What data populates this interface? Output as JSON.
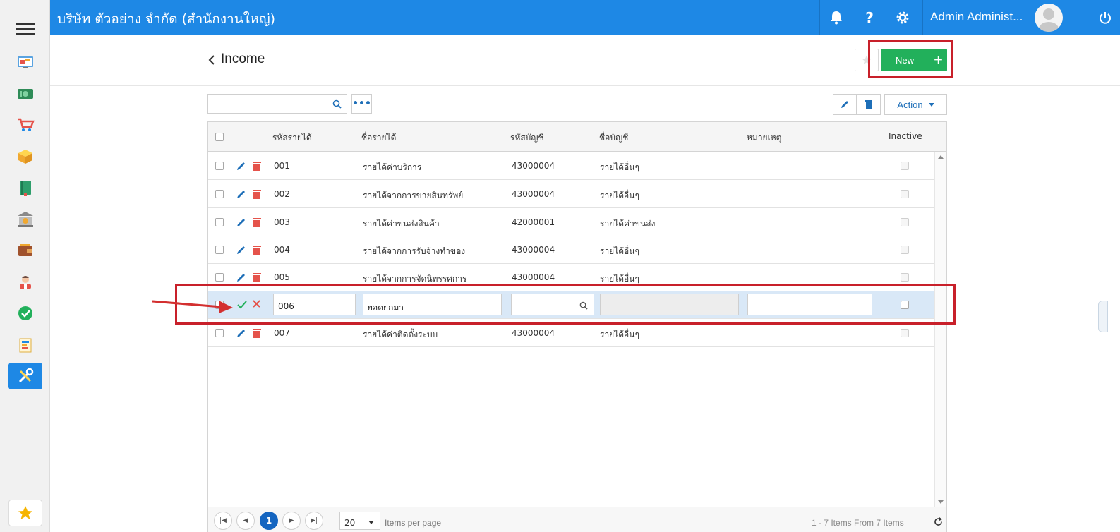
{
  "topbar": {
    "company": "บริษัท ตัวอย่าง จำกัด (สำนักงานใหญ่)",
    "user_name": "Admin Administ..."
  },
  "icons": {
    "sidebar": [
      "dashboard-icon",
      "money-icon",
      "cart-icon",
      "box-icon",
      "book-icon",
      "bank-icon",
      "wallet-icon",
      "employee-icon",
      "check-circle-icon",
      "report-icon",
      "tools-icon"
    ],
    "favorites": "star-icon"
  },
  "page": {
    "title": "Income",
    "new_label": "New",
    "new_plus": "+"
  },
  "toolbar": {
    "search_value": "",
    "more_label": "•••",
    "action_label": "Action"
  },
  "grid": {
    "columns": [
      "รหัสรายได้",
      "ชื่อรายได้",
      "รหัสบัญชี",
      "ชื่อบัญชี",
      "หมายเหตุ",
      "Inactive"
    ],
    "rows": [
      {
        "code": "001",
        "name": "รายได้ค่าบริการ",
        "account_code": "43000004",
        "account_name": "รายได้อื่นๆ",
        "note": ""
      },
      {
        "code": "002",
        "name": "รายได้จากการขายสินทรัพย์",
        "account_code": "43000004",
        "account_name": "รายได้อื่นๆ",
        "note": ""
      },
      {
        "code": "003",
        "name": "รายได้ค่าขนส่งสินค้า",
        "account_code": "42000001",
        "account_name": "รายได้ค่าขนส่ง",
        "note": ""
      },
      {
        "code": "004",
        "name": "รายได้จากการรับจ้างทำของ",
        "account_code": "43000004",
        "account_name": "รายได้อื่นๆ",
        "note": ""
      },
      {
        "code": "005",
        "name": "รายได้จากการจัดนิทรรศการ",
        "account_code": "43000004",
        "account_name": "รายได้อื่นๆ",
        "note": ""
      }
    ],
    "edit_row": {
      "code": "006",
      "name": "ยอดยกมา",
      "account_code": "",
      "account_name": "",
      "note": ""
    },
    "last_row": {
      "code": "007",
      "name": "รายได้ค่าติดตั้งระบบ",
      "account_code": "43000004",
      "account_name": "รายได้อื่นๆ",
      "note": ""
    }
  },
  "pager": {
    "current_page": "1",
    "page_size": "20",
    "items_per_page_label": "Items per page",
    "info": "1 - 7 Items From 7 Items"
  },
  "colors": {
    "brand": "#1e88e5",
    "new_button": "#22b05b",
    "highlight": "#c8202a",
    "edit_icon": "#1e6fb8",
    "delete_icon": "#e5534b"
  }
}
